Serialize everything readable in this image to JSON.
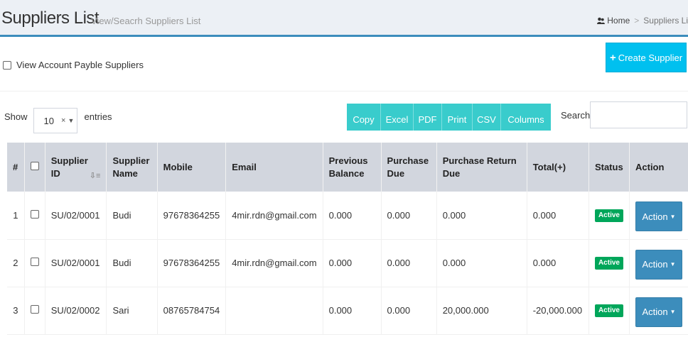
{
  "header": {
    "title": "Suppliers List",
    "subtitle": "View/Seacrh Suppliers List",
    "breadcrumb": {
      "home": "Home",
      "current": "Suppliers Li"
    }
  },
  "controls": {
    "view_payable_label": "View Account Payble Suppliers",
    "create_button": "Create Supplier",
    "show_label": "Show",
    "entries_value": "10",
    "entries_label": "entries",
    "export_buttons": [
      "Copy",
      "Excel",
      "PDF",
      "Print",
      "CSV",
      "Columns"
    ],
    "search_label": "Search:",
    "search_value": ""
  },
  "table": {
    "columns": [
      "#",
      "Supplier ID",
      "Supplier Name",
      "Mobile",
      "Email",
      "Previous Balance",
      "Purchase Due",
      "Purchase Return Due",
      "Total(+)",
      "Status",
      "Action"
    ],
    "rows": [
      {
        "no": "1",
        "id": "SU/02/0001",
        "name": "Budi",
        "mobile": "97678364255",
        "email": "4mir.rdn@gmail.com",
        "prev_balance": "0.000",
        "purchase_due": "0.000",
        "return_due": "0.000",
        "total": "0.000",
        "status": "Active",
        "action": "Action"
      },
      {
        "no": "2",
        "id": "SU/02/0001",
        "name": "Budi",
        "mobile": "97678364255",
        "email": "4mir.rdn@gmail.com",
        "prev_balance": "0.000",
        "purchase_due": "0.000",
        "return_due": "0.000",
        "total": "0.000",
        "status": "Active",
        "action": "Action"
      },
      {
        "no": "3",
        "id": "SU/02/0002",
        "name": "Sari",
        "mobile": "08765784754",
        "email": "",
        "prev_balance": "0.000",
        "purchase_due": "0.000",
        "return_due": "20,000.000",
        "total": "-20,000.000",
        "status": "Active",
        "action": "Action"
      }
    ]
  },
  "colors": {
    "accent": "#3c8dbc",
    "info": "#00c0ef",
    "teal": "#39cccc",
    "success": "#00a65a",
    "header_bg": "#d2d6de"
  }
}
